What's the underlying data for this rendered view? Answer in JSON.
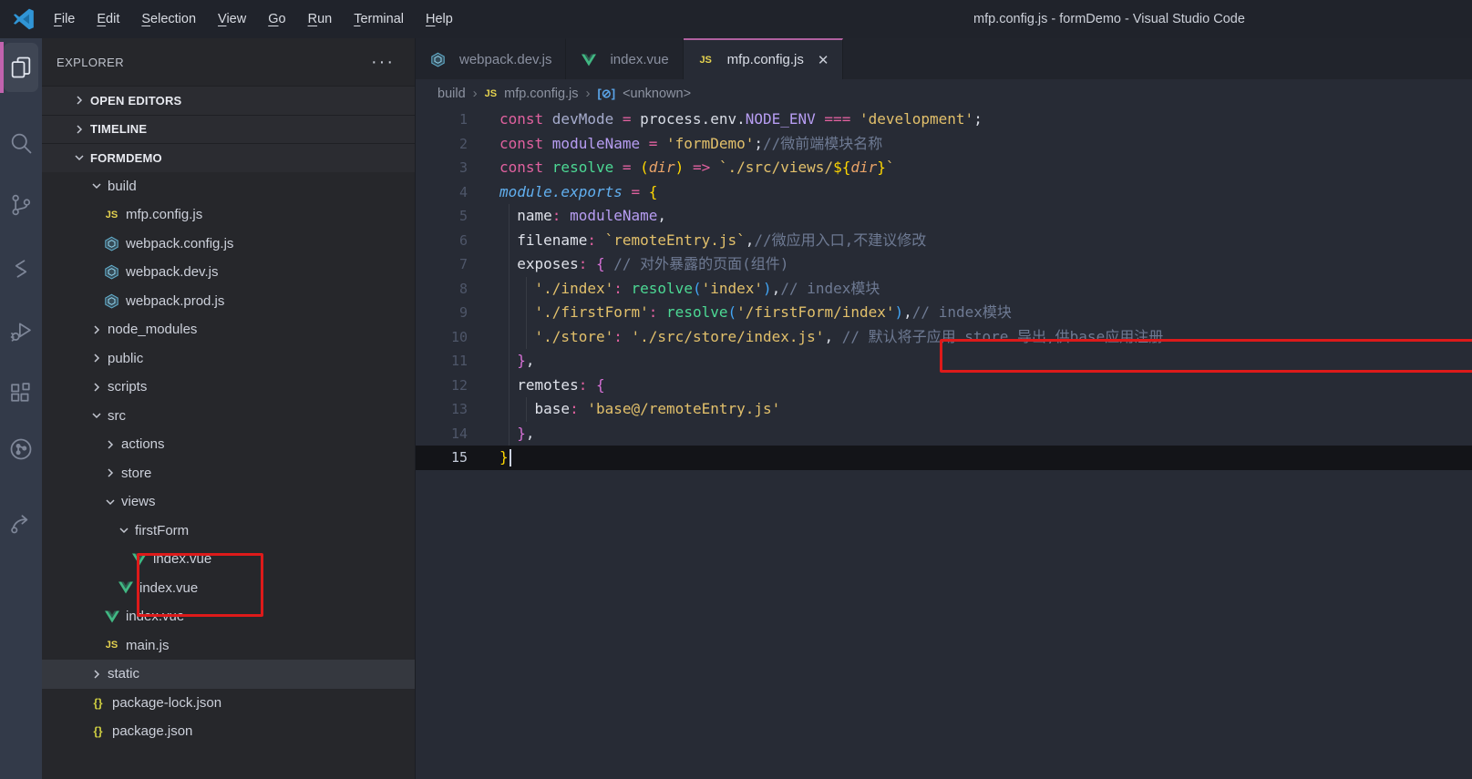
{
  "window": {
    "title": "mfp.config.js - formDemo - Visual Studio Code"
  },
  "menu_bar": {
    "items": [
      "File",
      "Edit",
      "Selection",
      "View",
      "Go",
      "Run",
      "Terminal",
      "Help"
    ]
  },
  "activity_bar": {
    "active_indicator_color": "#c163ae",
    "items": [
      {
        "name": "explorer-icon",
        "active": true
      },
      {
        "name": "search-icon",
        "active": false
      },
      {
        "name": "source-control-icon",
        "active": false
      },
      {
        "name": "extension-s-icon",
        "active": false
      },
      {
        "name": "run-debug-icon",
        "active": false
      },
      {
        "name": "extensions-icon",
        "active": false
      },
      {
        "name": "project-graph-icon",
        "active": false
      },
      {
        "name": "live-share-icon",
        "active": false
      }
    ]
  },
  "sidebar": {
    "header": {
      "title": "EXPLORER",
      "more_icon": "···"
    },
    "tree": [
      {
        "label": "OPEN EDITORS",
        "kind": "section",
        "chev": "right"
      },
      {
        "label": "TIMELINE",
        "kind": "section",
        "chev": "right"
      },
      {
        "label": "FORMDEMO",
        "kind": "section",
        "chev": "down"
      },
      {
        "label": "build",
        "kind": "folder",
        "chev": "down",
        "indent": 1
      },
      {
        "label": "mfp.config.js",
        "kind": "file",
        "icon": "js",
        "indent": 2
      },
      {
        "label": "webpack.config.js",
        "kind": "file",
        "icon": "webpack",
        "indent": 2
      },
      {
        "label": "webpack.dev.js",
        "kind": "file",
        "icon": "webpack",
        "indent": 2
      },
      {
        "label": "webpack.prod.js",
        "kind": "file",
        "icon": "webpack",
        "indent": 2
      },
      {
        "label": "node_modules",
        "kind": "folder",
        "chev": "right",
        "indent": 1
      },
      {
        "label": "public",
        "kind": "folder",
        "chev": "right",
        "indent": 1
      },
      {
        "label": "scripts",
        "kind": "folder",
        "chev": "right",
        "indent": 1
      },
      {
        "label": "src",
        "kind": "folder",
        "chev": "down",
        "indent": 1
      },
      {
        "label": "actions",
        "kind": "folder",
        "chev": "right",
        "indent": 2
      },
      {
        "label": "store",
        "kind": "folder",
        "chev": "right",
        "indent": 2
      },
      {
        "label": "views",
        "kind": "folder",
        "chev": "down",
        "indent": 2
      },
      {
        "label": "firstForm",
        "kind": "folder",
        "chev": "down",
        "indent": 3
      },
      {
        "label": "index.vue",
        "kind": "file",
        "icon": "vue",
        "indent": 4
      },
      {
        "label": "index.vue",
        "kind": "file",
        "icon": "vue",
        "indent": 3
      },
      {
        "label": "index.vue",
        "kind": "file",
        "icon": "vue",
        "indent": 2
      },
      {
        "label": "main.js",
        "kind": "file",
        "icon": "js",
        "indent": 2
      },
      {
        "label": "static",
        "kind": "folder",
        "chev": "right",
        "indent": 1,
        "selected": true
      },
      {
        "label": "package-lock.json",
        "kind": "file",
        "icon": "json",
        "indent": 1
      },
      {
        "label": "package.json",
        "kind": "file",
        "icon": "json",
        "indent": 1
      }
    ]
  },
  "editor": {
    "tabs": [
      {
        "label": "webpack.dev.js",
        "icon": "webpack",
        "active": false
      },
      {
        "label": "index.vue",
        "icon": "vue",
        "active": false
      },
      {
        "label": "mfp.config.js",
        "icon": "js",
        "active": true,
        "close": "✕"
      }
    ],
    "breadcrumb": {
      "separator": "›",
      "items": [
        {
          "label": "build"
        },
        {
          "label": "mfp.config.js",
          "icon": "js"
        },
        {
          "label": "<unknown>",
          "icon": "symbol"
        }
      ]
    },
    "token_colors": {
      "kw": "#e0619f",
      "op": "#e0619f",
      "var": "#a6accd",
      "pvar": "#b79df2",
      "plain": "#d9dde6",
      "prop": "#dfe2ea",
      "str": "#e2c06b",
      "fn": "#4cd894",
      "b1": "#ffd700",
      "b2": "#d670d6",
      "b3": "#42a5f5",
      "cm": "#6e7a93",
      "mod": "#61afef",
      "param": "#e8a368"
    },
    "lines": [
      {
        "num": 1,
        "guides": [],
        "tokens": [
          [
            "kw",
            "const "
          ],
          [
            "var",
            "devMode "
          ],
          [
            "op",
            "= "
          ],
          [
            "plain",
            "process.env."
          ],
          [
            "pvar",
            "NODE_ENV "
          ],
          [
            "op",
            "=== "
          ],
          [
            "str",
            "'development'"
          ],
          [
            "plain",
            ";"
          ]
        ]
      },
      {
        "num": 2,
        "guides": [],
        "tokens": [
          [
            "kw",
            "const "
          ],
          [
            "pvar",
            "moduleName "
          ],
          [
            "op",
            "= "
          ],
          [
            "str",
            "'formDemo'"
          ],
          [
            "plain",
            ";"
          ],
          [
            "cm",
            "//微前端模块名称"
          ]
        ]
      },
      {
        "num": 3,
        "guides": [],
        "tokens": [
          [
            "kw",
            "const "
          ],
          [
            "fn",
            "resolve "
          ],
          [
            "op",
            "= "
          ],
          [
            "b1",
            "("
          ],
          [
            "param",
            "dir"
          ],
          [
            "b1",
            ")"
          ],
          [
            "op",
            " => "
          ],
          [
            "str",
            "`./src/views/"
          ],
          [
            "b1",
            "${"
          ],
          [
            "param",
            "dir"
          ],
          [
            "b1",
            "}"
          ],
          [
            "str",
            "`"
          ]
        ]
      },
      {
        "num": 4,
        "guides": [],
        "tokens": [
          [
            "mod",
            "module.exports "
          ],
          [
            "op",
            "= "
          ],
          [
            "b1",
            "{"
          ]
        ]
      },
      {
        "num": 5,
        "guides": [
          1
        ],
        "tokens": [
          [
            "plain",
            "  "
          ],
          [
            "prop",
            "name"
          ],
          [
            "op",
            ":"
          ],
          [
            "plain",
            " "
          ],
          [
            "pvar",
            "moduleName"
          ],
          [
            "plain",
            ","
          ]
        ]
      },
      {
        "num": 6,
        "guides": [
          1
        ],
        "tokens": [
          [
            "plain",
            "  "
          ],
          [
            "prop",
            "filename"
          ],
          [
            "op",
            ":"
          ],
          [
            "plain",
            " "
          ],
          [
            "str",
            "`remoteEntry.js`"
          ],
          [
            "plain",
            ","
          ],
          [
            "cm",
            "//微应用入口,不建议修改"
          ]
        ]
      },
      {
        "num": 7,
        "guides": [
          1
        ],
        "tokens": [
          [
            "plain",
            "  "
          ],
          [
            "prop",
            "exposes"
          ],
          [
            "op",
            ":"
          ],
          [
            "plain",
            " "
          ],
          [
            "b2",
            "{ "
          ],
          [
            "cm",
            "// 对外暴露的页面(组件)"
          ]
        ]
      },
      {
        "num": 8,
        "guides": [
          1,
          3
        ],
        "tokens": [
          [
            "plain",
            "    "
          ],
          [
            "str",
            "'./index'"
          ],
          [
            "op",
            ":"
          ],
          [
            "plain",
            " "
          ],
          [
            "fn",
            "resolve"
          ],
          [
            "b3",
            "("
          ],
          [
            "str",
            "'index'"
          ],
          [
            "b3",
            ")"
          ],
          [
            "plain",
            ","
          ],
          [
            "cm",
            "// index模块"
          ]
        ]
      },
      {
        "num": 9,
        "guides": [
          1,
          3
        ],
        "tokens": [
          [
            "plain",
            "    "
          ],
          [
            "str",
            "'./firstForm'"
          ],
          [
            "op",
            ":"
          ],
          [
            "plain",
            " "
          ],
          [
            "fn",
            "resolve"
          ],
          [
            "b3",
            "("
          ],
          [
            "str",
            "'/firstForm/index'"
          ],
          [
            "b3",
            ")"
          ],
          [
            "plain",
            ","
          ],
          [
            "cm",
            "// index模块"
          ]
        ]
      },
      {
        "num": 10,
        "guides": [
          1,
          3
        ],
        "tokens": [
          [
            "plain",
            "    "
          ],
          [
            "str",
            "'./store'"
          ],
          [
            "op",
            ":"
          ],
          [
            "plain",
            " "
          ],
          [
            "str",
            "'./src/store/index.js'"
          ],
          [
            "plain",
            ", "
          ],
          [
            "cm",
            "// 默认将子应用 store 导出,供base应用注册"
          ]
        ]
      },
      {
        "num": 11,
        "guides": [
          1
        ],
        "tokens": [
          [
            "plain",
            "  "
          ],
          [
            "b2",
            "}"
          ],
          [
            "plain",
            ","
          ]
        ]
      },
      {
        "num": 12,
        "guides": [
          1
        ],
        "tokens": [
          [
            "plain",
            "  "
          ],
          [
            "prop",
            "remotes"
          ],
          [
            "op",
            ":"
          ],
          [
            "plain",
            " "
          ],
          [
            "b2",
            "{"
          ]
        ]
      },
      {
        "num": 13,
        "guides": [
          1,
          3
        ],
        "tokens": [
          [
            "plain",
            "    "
          ],
          [
            "prop",
            "base"
          ],
          [
            "op",
            ":"
          ],
          [
            "plain",
            " "
          ],
          [
            "str",
            "'base@/remoteEntry.js'"
          ]
        ]
      },
      {
        "num": 14,
        "guides": [
          1
        ],
        "tokens": [
          [
            "plain",
            "  "
          ],
          [
            "b2",
            "}"
          ],
          [
            "plain",
            ","
          ]
        ]
      },
      {
        "num": 15,
        "guides": [],
        "current": true,
        "cursor": true,
        "tokens": [
          [
            "b1",
            "}"
          ]
        ]
      }
    ]
  },
  "annotations": {
    "box_color": "#dd1a1a"
  }
}
